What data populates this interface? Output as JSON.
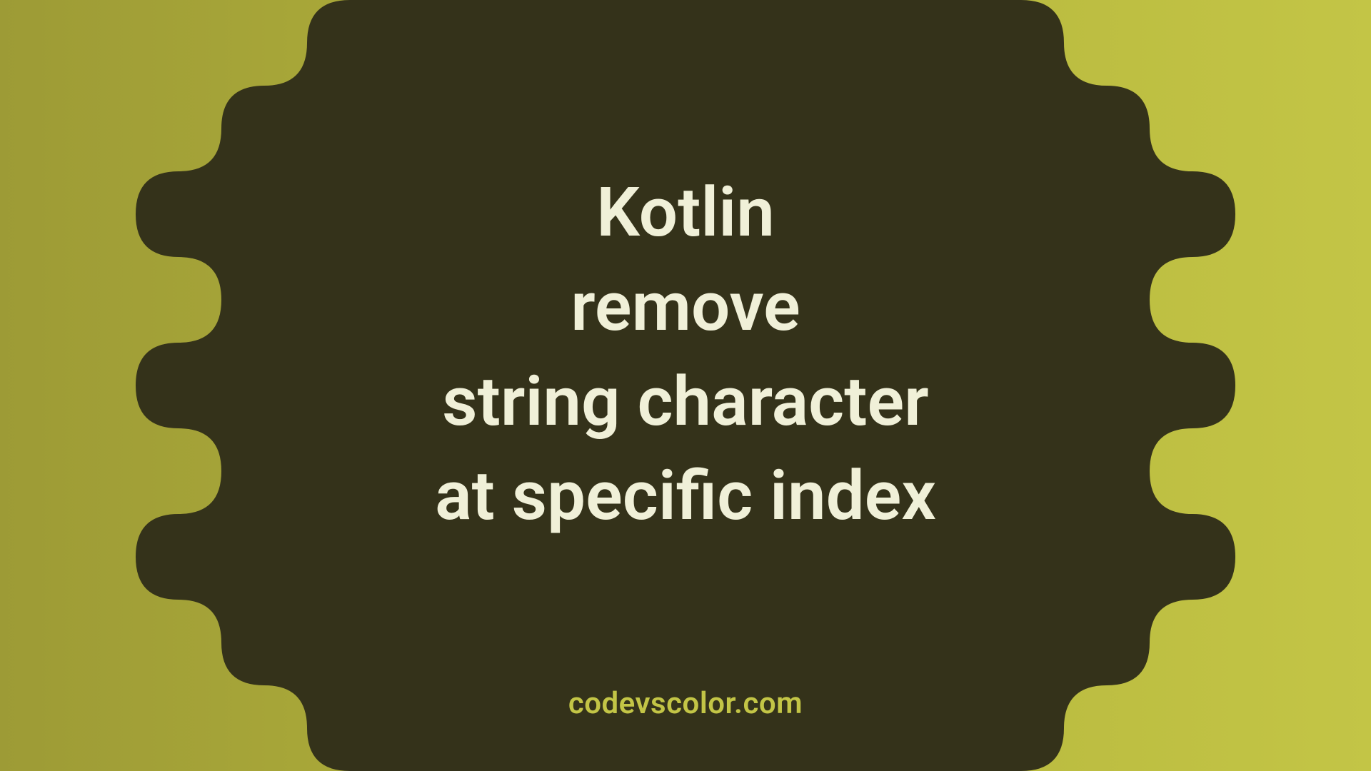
{
  "title_lines": "Kotlin\nremove\nstring character\nat specific index",
  "watermark": "codevscolor.com",
  "colors": {
    "bg_gradient_start": "#9d9b36",
    "bg_gradient_mid": "#b4b43b",
    "bg_gradient_end": "#c3c546",
    "blob": "#34321a",
    "title_text": "#f0f0d8",
    "watermark_text": "#c3c546"
  }
}
